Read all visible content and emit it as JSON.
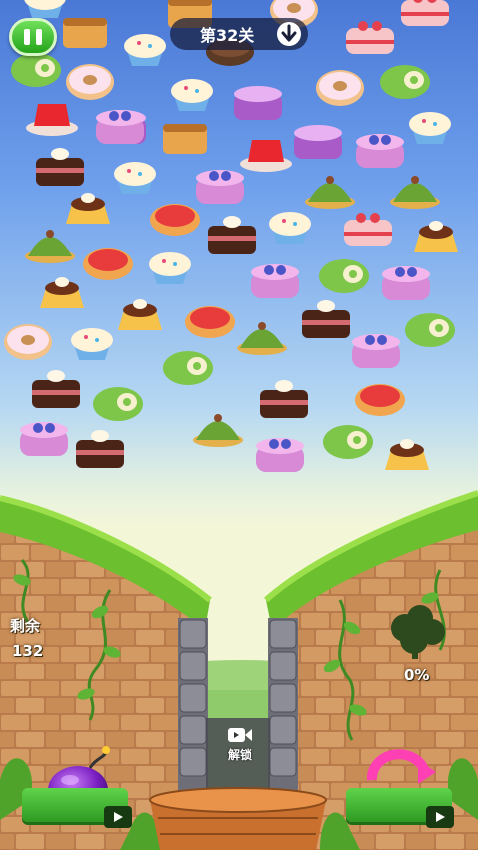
{
  "hud": {
    "pause_icon": "pause-icon",
    "level_label": "第32关",
    "drop_icon": "arrow-down-icon"
  },
  "counter": {
    "remaining_label": "剩余",
    "remaining_value": "132"
  },
  "progress": {
    "value_text": "0%",
    "fraction": 0
  },
  "unlock": {
    "icon": "video-camera-icon",
    "label": "解锁"
  },
  "powerups": {
    "left_item": "bomb-icon",
    "right_item": "swap-arrows-icon",
    "ad_icon": "play-video-icon"
  },
  "colors": {
    "accent_green": "#3fbf2c",
    "brick": "#c98a55",
    "sky_top": "#4a78d6"
  }
}
